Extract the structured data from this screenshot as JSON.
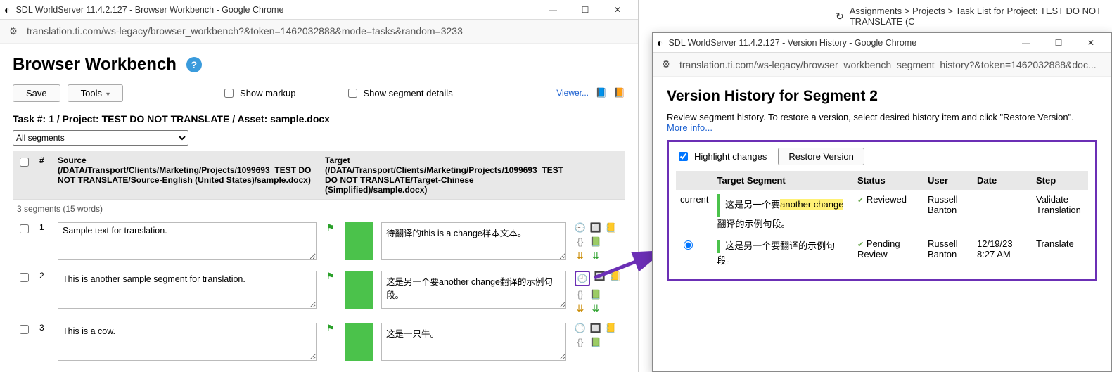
{
  "bg_window": {
    "breadcrumb_icon": "↻",
    "breadcrumb": "Assignments > Projects > Task List for Project: TEST DO NOT TRANSLATE (C"
  },
  "left": {
    "title": "SDL WorldServer 11.4.2.127 - Browser Workbench - Google Chrome",
    "url": "translation.ti.com/ws-legacy/browser_workbench?&token=1462032888&mode=tasks&random=3233",
    "page_title": "Browser Workbench",
    "save_label": "Save",
    "tools_label": "Tools",
    "show_markup_label": "Show markup",
    "show_segdetails_label": "Show segment details",
    "viewer_label": "Viewer...",
    "task_line": "Task #: 1 / Project: TEST DO NOT TRANSLATE / Asset: sample.docx",
    "filter_value": "All segments",
    "col_num": "#",
    "col_source": "Source (/DATA/Transport/Clients/Marketing/Projects/1099693_TEST DO NOT TRANSLATE/Source-English (United States)/sample.docx)",
    "col_target": "Target (/DATA/Transport/Clients/Marketing/Projects/1099693_TEST DO NOT TRANSLATE/Target-Chinese (Simplified)/sample.docx)",
    "seg_count": "3 segments (15 words)",
    "rows": [
      {
        "n": "1",
        "src": "Sample text for translation.",
        "tgt": "待翻译的this is a change样本文本。"
      },
      {
        "n": "2",
        "src": "This is another sample segment for translation.",
        "tgt": "这是另一个要another change翻译的示例句段。"
      },
      {
        "n": "3",
        "src": "This is a cow.",
        "tgt": "这是一只牛。"
      }
    ]
  },
  "right": {
    "title": "SDL WorldServer 11.4.2.127 - Version History - Google Chrome",
    "url": "translation.ti.com/ws-legacy/browser_workbench_segment_history?&token=1462032888&doc...",
    "heading": "Version History for Segment 2",
    "desc_prefix": "Review segment history. To restore a version, select desired history item and click \"Restore Version\". ",
    "more_info": "More info...",
    "highlight_label": "Highlight changes",
    "restore_label": "Restore Version",
    "th_target": "Target Segment",
    "th_status": "Status",
    "th_user": "User",
    "th_date": "Date",
    "th_step": "Step",
    "current_label": "current",
    "rows": [
      {
        "sel": "",
        "tgt_pre": "这是另一个要",
        "tgt_hi": "another change",
        "tgt_post": "翻译的示例句段。",
        "status": "Reviewed",
        "user": "Russell Banton",
        "date": "",
        "step": "Validate Translation"
      },
      {
        "sel": "radio",
        "tgt_full": "这是另一个要翻译的示例句段。",
        "status": "Pending Review",
        "user": "Russell Banton",
        "date": "12/19/23 8:27 AM",
        "step": "Translate"
      }
    ]
  }
}
